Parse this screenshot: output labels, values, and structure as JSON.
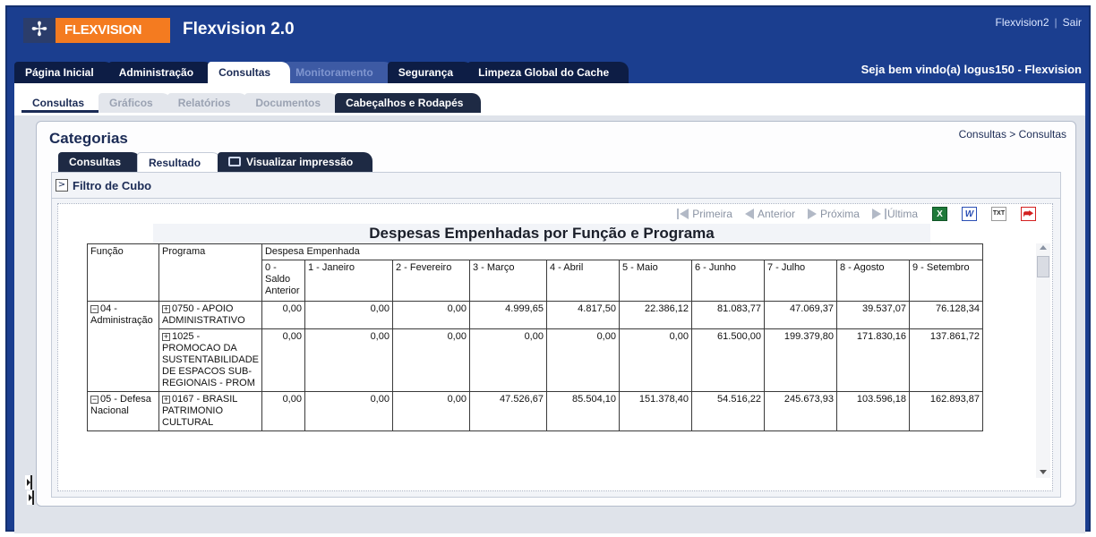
{
  "header": {
    "logo_text": "FLEXVISION",
    "app_title": "Flexvision 2.0",
    "user_link": "Flexvision2",
    "logout_link": "Sair",
    "welcome": "Seja bem vindo(a) logus150 - Flexvision"
  },
  "main_tabs": [
    {
      "label": "Página Inicial",
      "state": "normal"
    },
    {
      "label": "Administração",
      "state": "normal"
    },
    {
      "label": "Consultas",
      "state": "active"
    },
    {
      "label": "Monitoramento",
      "state": "disabled"
    },
    {
      "label": "Segurança",
      "state": "normal"
    },
    {
      "label": "Limpeza Global do Cache",
      "state": "normal"
    }
  ],
  "sub_tabs": [
    {
      "label": "Consultas",
      "state": "active"
    },
    {
      "label": "Gráficos",
      "state": "normal"
    },
    {
      "label": "Relatórios",
      "state": "normal"
    },
    {
      "label": "Documentos",
      "state": "normal"
    },
    {
      "label": "Cabeçalhos e Rodapés",
      "state": "dark"
    }
  ],
  "panel": {
    "title": "Categorias",
    "breadcrumb": "Consultas > Consultas",
    "tabs": [
      {
        "label": "Consultas"
      },
      {
        "label": "Resultado"
      },
      {
        "label": "Visualizar impressão"
      }
    ],
    "filter_label": "Filtro de Cubo"
  },
  "toolbar": {
    "first": "Primeira",
    "previous": "Anterior",
    "next": "Próxima",
    "last": "Última"
  },
  "report": {
    "title": "Despesas Empenhadas por Função e Programa",
    "col_funcao": "Função",
    "col_programa": "Programa",
    "col_group": "Despesa Empenhada",
    "months": [
      "0 - Saldo Anterior",
      "1 - Janeiro",
      "2 - Fevereiro",
      "3 - Março",
      "4 - Abril",
      "5 - Maio",
      "6 - Junho",
      "7 - Julho",
      "8 - Agosto",
      "9 - Setembro"
    ],
    "rows": [
      {
        "funcao": "04 - Administração",
        "programas": [
          {
            "programa": "0750 - APOIO ADMINISTRATIVO",
            "values": [
              "0,00",
              "0,00",
              "0,00",
              "4.999,65",
              "4.817,50",
              "22.386,12",
              "81.083,77",
              "47.069,37",
              "39.537,07",
              "76.128,34"
            ]
          },
          {
            "programa": "1025 - PROMOCAO DA SUSTENTABILIDADE DE ESPACOS SUB-REGIONAIS - PROM",
            "values": [
              "0,00",
              "0,00",
              "0,00",
              "0,00",
              "0,00",
              "0,00",
              "61.500,00",
              "199.379,80",
              "171.830,16",
              "137.861,72"
            ]
          }
        ]
      },
      {
        "funcao": "05 - Defesa Nacional",
        "programas": [
          {
            "programa": "0167 - BRASIL PATRIMONIO CULTURAL",
            "values": [
              "0,00",
              "0,00",
              "0,00",
              "47.526,67",
              "85.504,10",
              "151.378,40",
              "54.516,22",
              "245.673,93",
              "103.596,18",
              "162.893,87"
            ]
          }
        ]
      }
    ]
  }
}
